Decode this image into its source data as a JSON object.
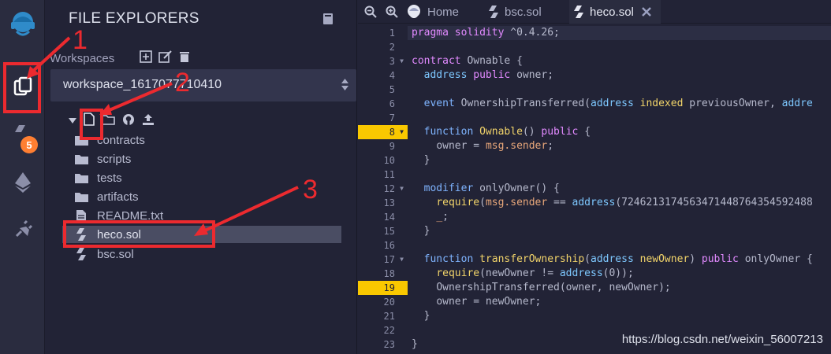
{
  "sidebar": {
    "plugin_badge": "5"
  },
  "explorer": {
    "title": "FILE EXPLORERS",
    "workspaces_label": "Workspaces",
    "workspace_selected": "workspace_1617077710410",
    "tree": [
      {
        "name": "contracts",
        "type": "folder"
      },
      {
        "name": "scripts",
        "type": "folder"
      },
      {
        "name": "tests",
        "type": "folder"
      },
      {
        "name": "artifacts",
        "type": "folder"
      },
      {
        "name": "README.txt",
        "type": "file"
      },
      {
        "name": "heco.sol",
        "type": "sol"
      },
      {
        "name": "bsc.sol",
        "type": "sol"
      }
    ]
  },
  "tabs": {
    "home": "Home",
    "bsc": "bsc.sol",
    "heco": "heco.sol"
  },
  "editor": {
    "line_numbers": [
      "1",
      "2",
      "3",
      "4",
      "5",
      "6",
      "7",
      "8",
      "9",
      "10",
      "11",
      "12",
      "13",
      "14",
      "15",
      "16",
      "17",
      "18",
      "19",
      "20",
      "21",
      "22",
      "23"
    ],
    "highlighted_lines": [
      8,
      19
    ],
    "fold_lines": [
      3,
      8,
      12,
      17
    ]
  },
  "annotations": {
    "n1": "1",
    "n2": "2",
    "n3": "3"
  },
  "watermark": "https://blog.csdn.net/weixin_56007213",
  "colors": {
    "accent": "#f9c800",
    "annotation": "#ec2a2f",
    "badge": "#ff7f32"
  }
}
